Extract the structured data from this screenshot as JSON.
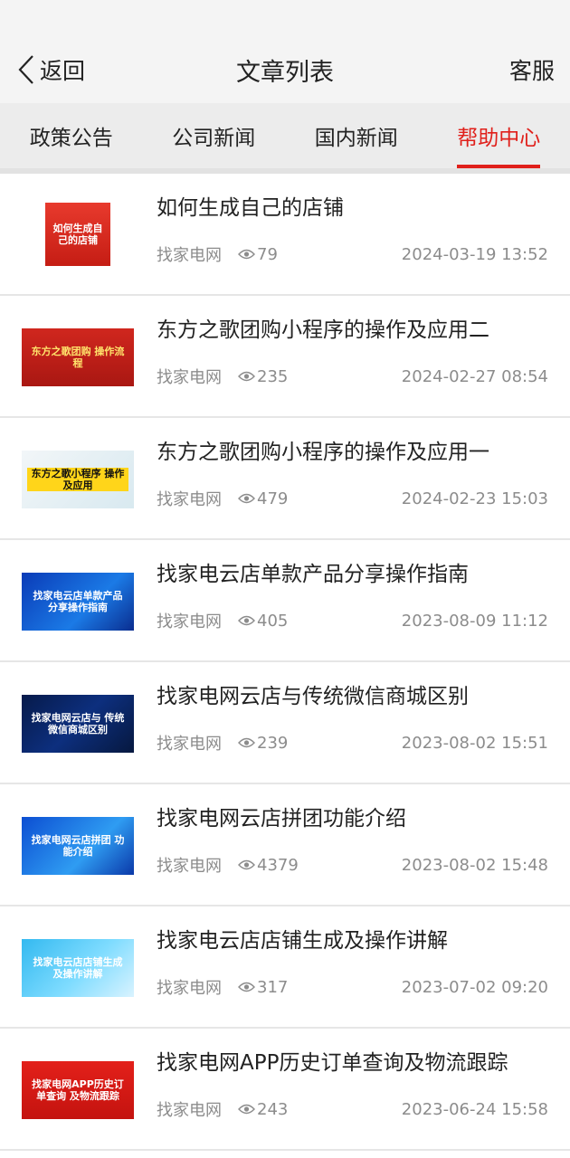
{
  "header": {
    "back_label": "返回",
    "title": "文章列表",
    "service_label": "客服"
  },
  "tabs": [
    {
      "label": "政策公告",
      "active": false
    },
    {
      "label": "公司新闻",
      "active": false
    },
    {
      "label": "国内新闻",
      "active": false
    },
    {
      "label": "帮助中心",
      "active": true
    }
  ],
  "articles": [
    {
      "title": "如何生成自己的店铺",
      "source": "找家电网",
      "views": "79",
      "date": "2024-03-19 13:52",
      "thumb_text": "如何生成自己的店铺"
    },
    {
      "title": "东方之歌团购小程序的操作及应用二",
      "source": "找家电网",
      "views": "235",
      "date": "2024-02-27 08:54",
      "thumb_text": "东方之歌团购 操作流程"
    },
    {
      "title": "东方之歌团购小程序的操作及应用一",
      "source": "找家电网",
      "views": "479",
      "date": "2024-02-23 15:03",
      "thumb_text": "东方之歌小程序 操作及应用"
    },
    {
      "title": "找家电云店单款产品分享操作指南",
      "source": "找家电网",
      "views": "405",
      "date": "2023-08-09 11:12",
      "thumb_text": "找家电云店单款产品 分享操作指南"
    },
    {
      "title": "找家电网云店与传统微信商城区别",
      "source": "找家电网",
      "views": "239",
      "date": "2023-08-02 15:51",
      "thumb_text": "找家电网云店与 传统微信商城区别"
    },
    {
      "title": "找家电网云店拼团功能介绍",
      "source": "找家电网",
      "views": "4379",
      "date": "2023-08-02 15:48",
      "thumb_text": "找家电网云店拼团 功能介绍"
    },
    {
      "title": "找家电云店店铺生成及操作讲解",
      "source": "找家电网",
      "views": "317",
      "date": "2023-07-02 09:20",
      "thumb_text": "找家电云店店铺生成 及操作讲解"
    },
    {
      "title": "找家电网APP历史订单查询及物流跟踪",
      "source": "找家电网",
      "views": "243",
      "date": "2023-06-24 15:58",
      "thumb_text": "找家电网APP历史订单查询 及物流跟踪"
    }
  ],
  "colors": {
    "accent": "#e0201b",
    "meta_text": "#8c8c8c"
  }
}
